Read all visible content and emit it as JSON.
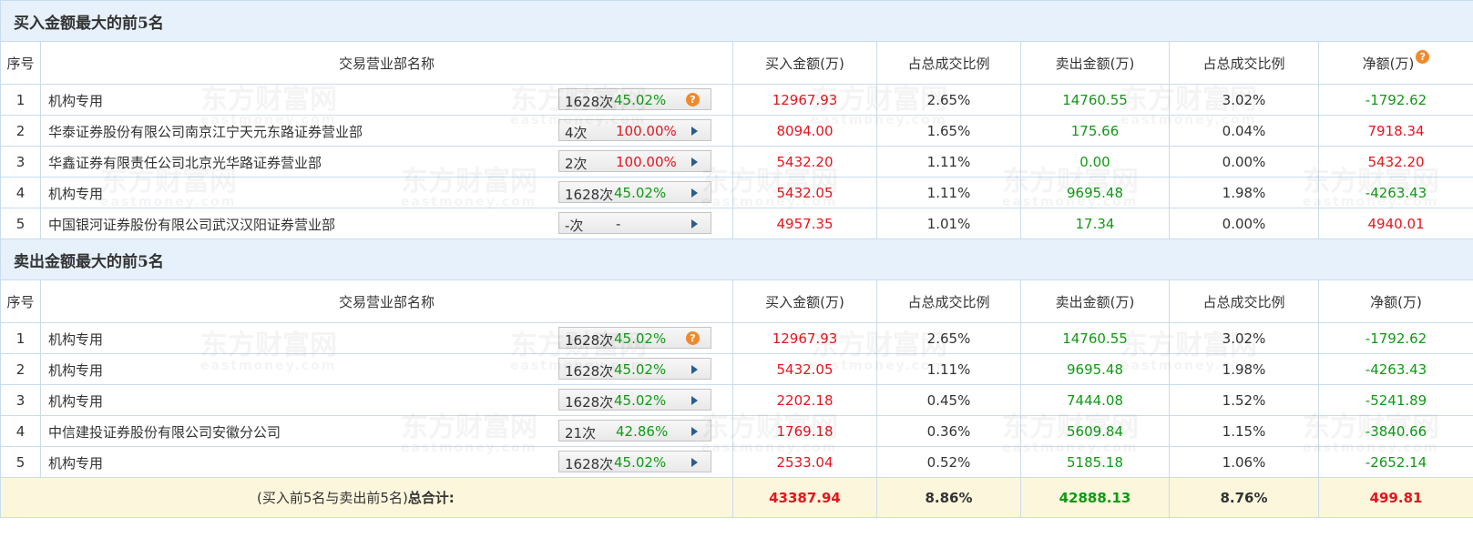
{
  "columns": {
    "index": "序号",
    "name": "交易营业部名称",
    "buy_amount": "买入金额(万)",
    "buy_pct": "占总成交比例",
    "sell_amount": "卖出金额(万)",
    "sell_pct": "占总成交比例",
    "net": "净额(万)"
  },
  "watermark": {
    "text": "东方财富网",
    "sub": "eastmoney.com"
  },
  "buy_section": {
    "title": "买入金额最大的前5名",
    "rows": [
      {
        "idx": "1",
        "name": "机构专用",
        "count": "1628次",
        "pct": "45.02%",
        "pct_color": "green",
        "icon": "help-icon",
        "buy": "12967.93",
        "buy_pct": "2.65%",
        "sell": "14760.55",
        "sell_pct": "3.02%",
        "net": "-1792.62",
        "net_color": "green"
      },
      {
        "idx": "2",
        "name": "华泰证券股份有限公司南京江宁天元东路证券营业部",
        "count": "4次",
        "pct": "100.00%",
        "pct_color": "red",
        "icon": "arrow-icon",
        "buy": "8094.00",
        "buy_pct": "1.65%",
        "sell": "175.66",
        "sell_pct": "0.04%",
        "net": "7918.34",
        "net_color": "red"
      },
      {
        "idx": "3",
        "name": "华鑫证券有限责任公司北京光华路证券营业部",
        "count": "2次",
        "pct": "100.00%",
        "pct_color": "red",
        "icon": "arrow-icon",
        "buy": "5432.20",
        "buy_pct": "1.11%",
        "sell": "0.00",
        "sell_pct": "0.00%",
        "net": "5432.20",
        "net_color": "red"
      },
      {
        "idx": "4",
        "name": "机构专用",
        "count": "1628次",
        "pct": "45.02%",
        "pct_color": "green",
        "icon": "arrow-icon",
        "buy": "5432.05",
        "buy_pct": "1.11%",
        "sell": "9695.48",
        "sell_pct": "1.98%",
        "net": "-4263.43",
        "net_color": "green"
      },
      {
        "idx": "5",
        "name": "中国银河证券股份有限公司武汉汉阳证券营业部",
        "count": "-次",
        "pct": "-",
        "pct_color": "gray",
        "icon": "arrow-icon",
        "buy": "4957.35",
        "buy_pct": "1.01%",
        "sell": "17.34",
        "sell_pct": "0.00%",
        "net": "4940.01",
        "net_color": "red"
      }
    ]
  },
  "sell_section": {
    "title": "卖出金额最大的前5名",
    "rows": [
      {
        "idx": "1",
        "name": "机构专用",
        "count": "1628次",
        "pct": "45.02%",
        "pct_color": "green",
        "icon": "help-icon",
        "buy": "12967.93",
        "buy_pct": "2.65%",
        "sell": "14760.55",
        "sell_pct": "3.02%",
        "net": "-1792.62",
        "net_color": "green"
      },
      {
        "idx": "2",
        "name": "机构专用",
        "count": "1628次",
        "pct": "45.02%",
        "pct_color": "green",
        "icon": "arrow-icon",
        "buy": "5432.05",
        "buy_pct": "1.11%",
        "sell": "9695.48",
        "sell_pct": "1.98%",
        "net": "-4263.43",
        "net_color": "green"
      },
      {
        "idx": "3",
        "name": "机构专用",
        "count": "1628次",
        "pct": "45.02%",
        "pct_color": "green",
        "icon": "arrow-icon",
        "buy": "2202.18",
        "buy_pct": "0.45%",
        "sell": "7444.08",
        "sell_pct": "1.52%",
        "net": "-5241.89",
        "net_color": "green"
      },
      {
        "idx": "4",
        "name": "中信建投证券股份有限公司安徽分公司",
        "count": "21次",
        "pct": "42.86%",
        "pct_color": "green",
        "icon": "arrow-icon",
        "buy": "1769.18",
        "buy_pct": "0.36%",
        "sell": "5609.84",
        "sell_pct": "1.15%",
        "net": "-3840.66",
        "net_color": "green"
      },
      {
        "idx": "5",
        "name": "机构专用",
        "count": "1628次",
        "pct": "45.02%",
        "pct_color": "green",
        "icon": "arrow-icon",
        "buy": "2533.04",
        "buy_pct": "0.52%",
        "sell": "5185.18",
        "sell_pct": "1.06%",
        "net": "-2652.14",
        "net_color": "green"
      }
    ]
  },
  "total": {
    "label_prefix": "(买入前5名与卖出前5名)",
    "label_bold": "总合计:",
    "buy": "43387.94",
    "buy_pct": "8.86%",
    "sell": "42888.13",
    "sell_pct": "8.76%",
    "net": "499.81"
  },
  "colors": {
    "red": "#e4161d",
    "green": "#119915",
    "gray": "#333333",
    "header_bg": "#e6f1fc",
    "total_bg": "#fcf7dc",
    "border": "#c9dcee",
    "help_icon": "#f08a2c"
  }
}
